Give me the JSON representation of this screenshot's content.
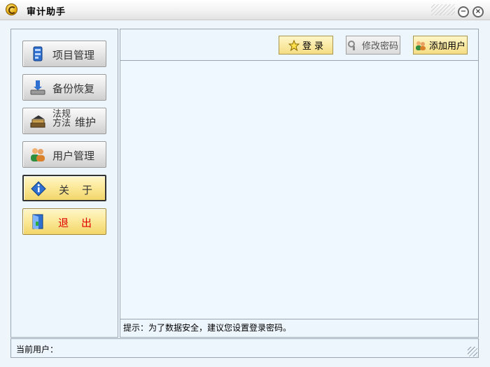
{
  "window": {
    "title": "审计助手",
    "icons": {
      "app": "app-logo-icon",
      "minimize": "minimize-icon",
      "close": "close-icon"
    },
    "minimize_glyph": "−",
    "close_glyph": "×"
  },
  "sidebar": {
    "items": [
      {
        "label": "项目管理",
        "icon": "project-book-icon"
      },
      {
        "label": "备份恢复",
        "icon": "backup-disk-icon"
      },
      {
        "label_line1": "法规",
        "label_line2": "方法",
        "label_suffix": "维护",
        "icon": "books-icon"
      },
      {
        "label": "用户管理",
        "icon": "users-icon"
      },
      {
        "label": "关于",
        "icon": "info-icon"
      },
      {
        "label": "退出",
        "icon": "exit-door-icon"
      }
    ]
  },
  "toolbar": {
    "login_label": "登 录",
    "change_password_label": "修改密码",
    "add_user_label": "添加用户"
  },
  "hint": {
    "text": "提示：为了数据安全，建议您设置登录密码。"
  },
  "status": {
    "current_user_label": "当前用户："
  },
  "colors": {
    "frame_bg": "#eef6fc",
    "border": "#9aa6b2",
    "exit_text": "#e00000",
    "button_yellow": "#fbe896"
  }
}
